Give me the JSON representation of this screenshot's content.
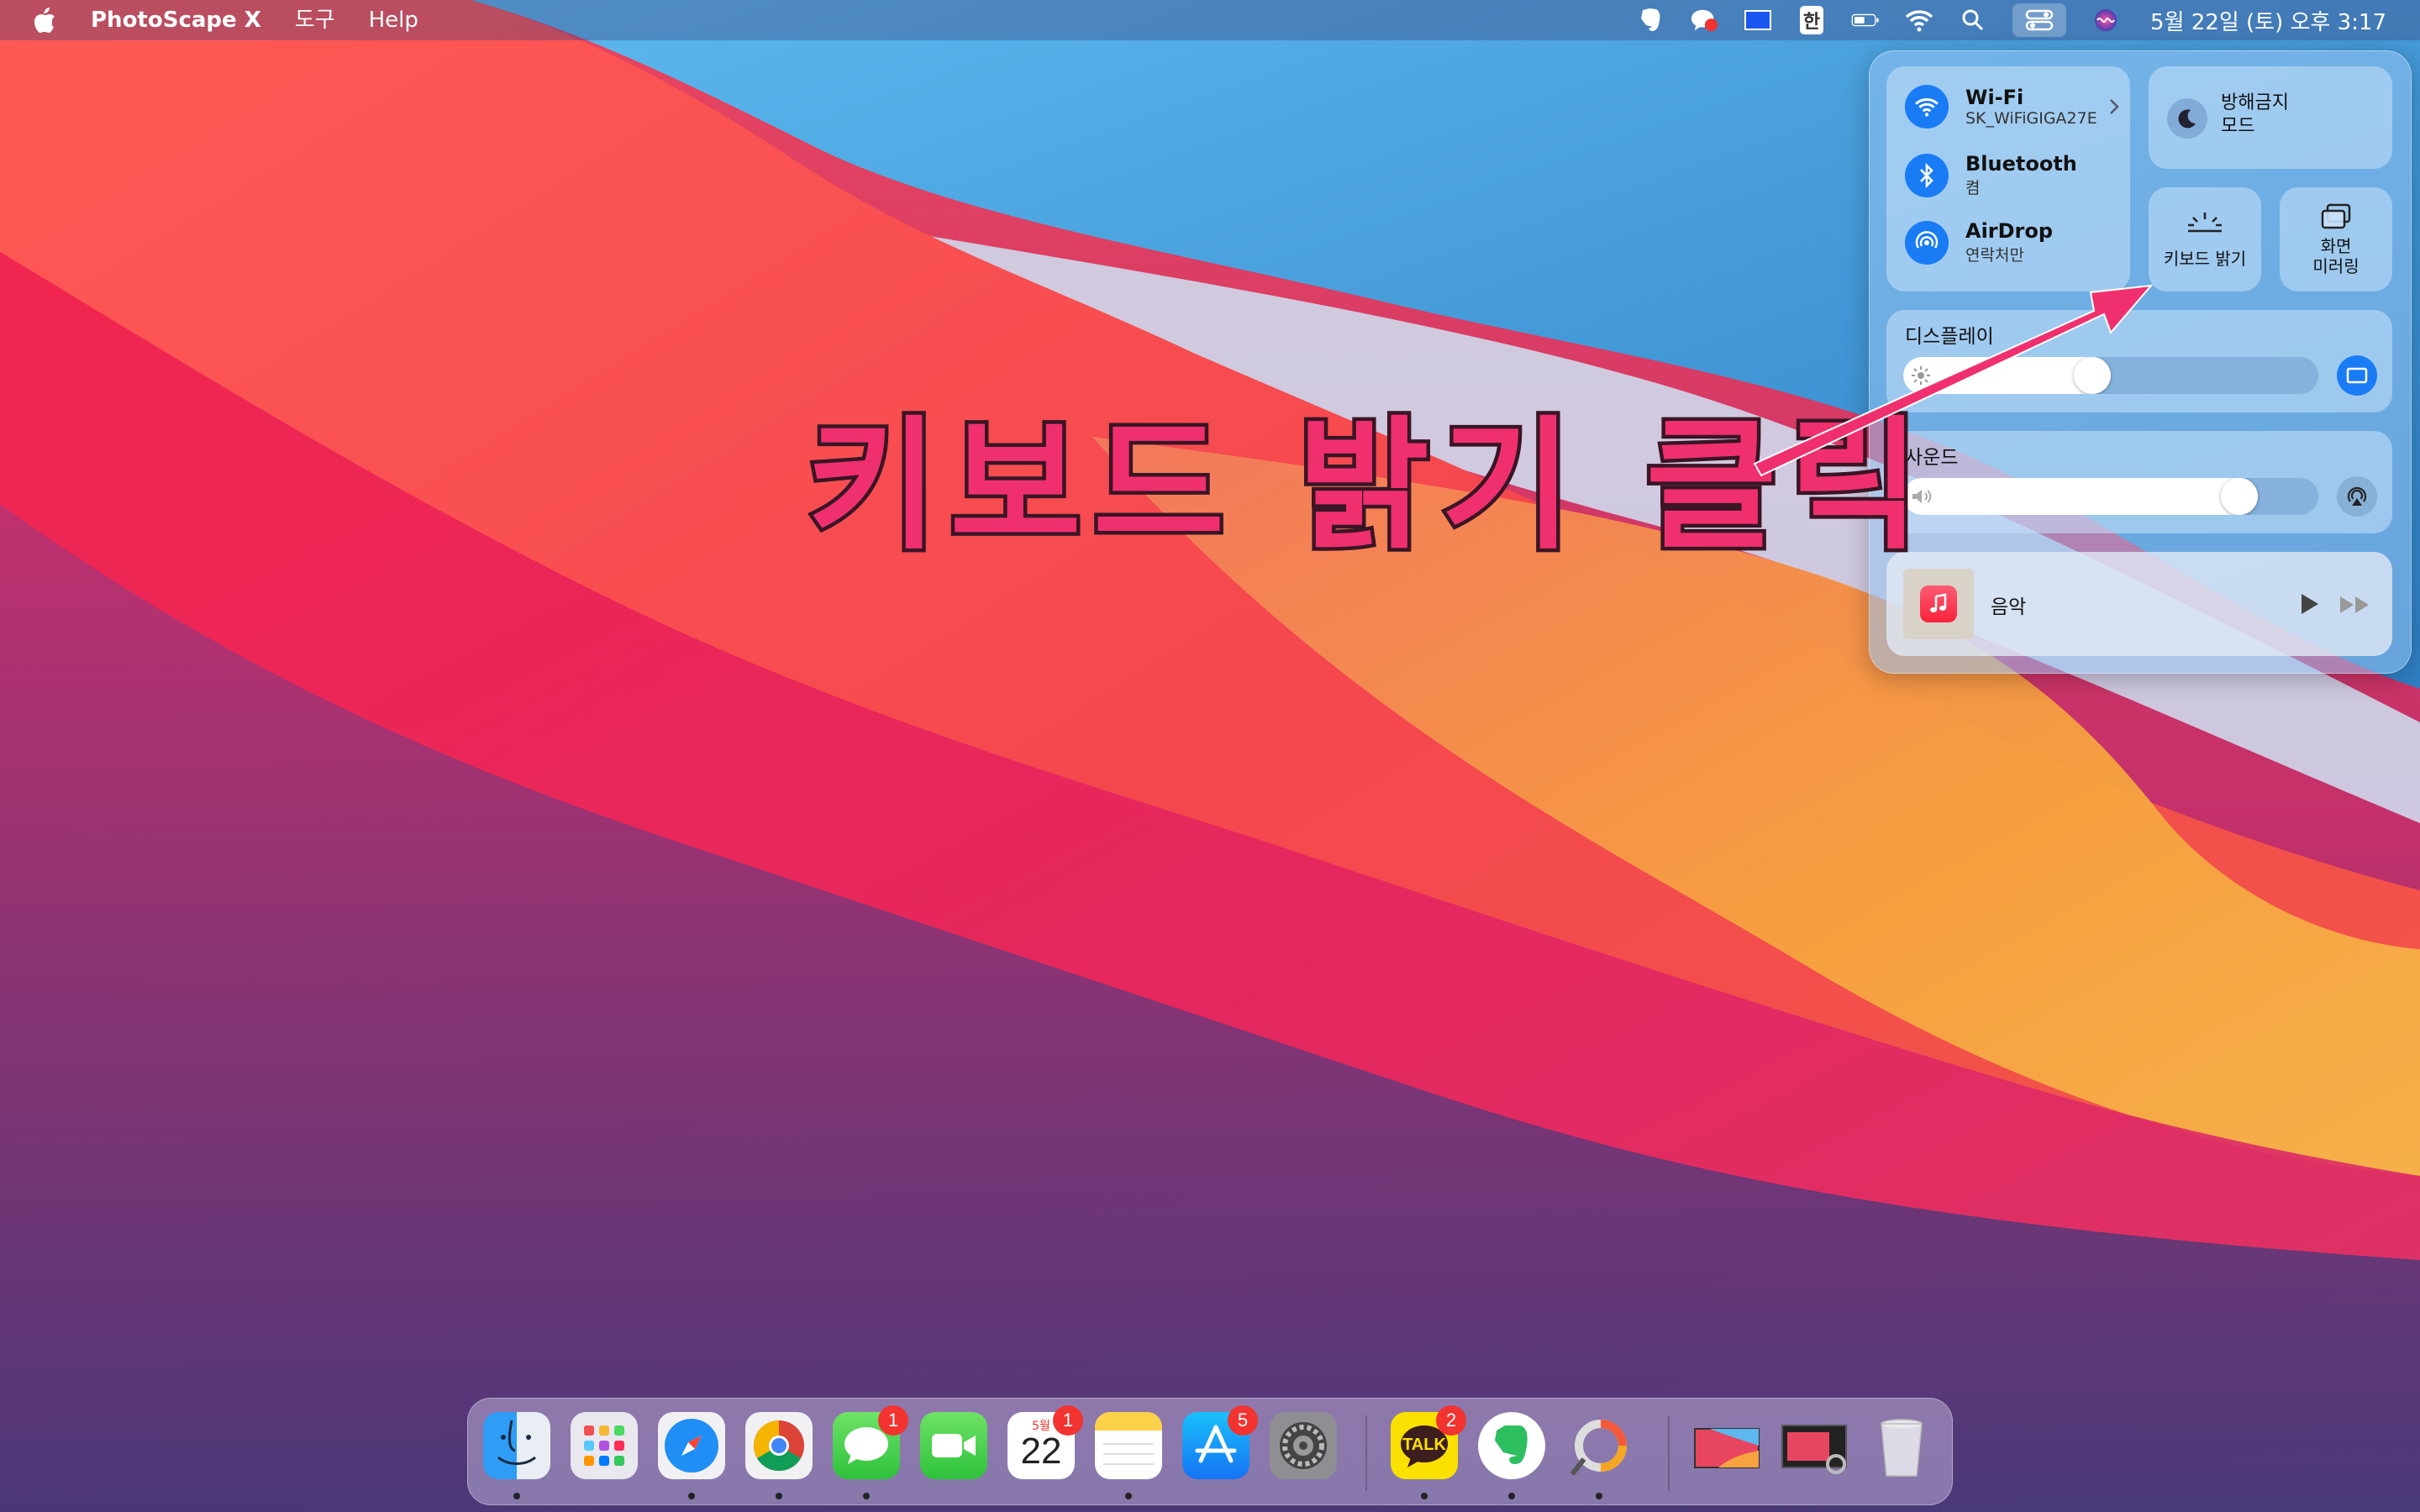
{
  "menubar": {
    "app_name": "PhotoScape X",
    "menus": [
      "도구",
      "Help"
    ],
    "clock": "5월 22일 (토) 오후 3:17",
    "input_method": "한"
  },
  "control_center": {
    "wifi": {
      "title": "Wi-Fi",
      "subtitle": "SK_WiFiGIGA27E"
    },
    "bluetooth": {
      "title": "Bluetooth",
      "subtitle": "켬"
    },
    "airdrop": {
      "title": "AirDrop",
      "subtitle": "연락처만"
    },
    "do_not_disturb": {
      "line1": "방해금지",
      "line2": "모드"
    },
    "keyboard_brightness": {
      "label": "키보드 밝기"
    },
    "screen_mirroring": {
      "line1": "화면",
      "line2": "미러링"
    },
    "display": {
      "title": "디스플레이",
      "level": 0.45
    },
    "sound": {
      "title": "사운드",
      "level": 0.84
    },
    "music": {
      "title": "음악"
    }
  },
  "overlay": {
    "caption": "키보드 밝기 클릭",
    "color": "#f0306e"
  },
  "dock": {
    "calendar": {
      "month": "5월",
      "day": "22"
    },
    "kakaotalk_label": "TALK",
    "badges": {
      "messages": "1",
      "calendar": "1",
      "app_store": "5",
      "kakaotalk": "2"
    }
  },
  "colors": {
    "accent": "#1a7cf5",
    "badge": "#f2332f"
  }
}
